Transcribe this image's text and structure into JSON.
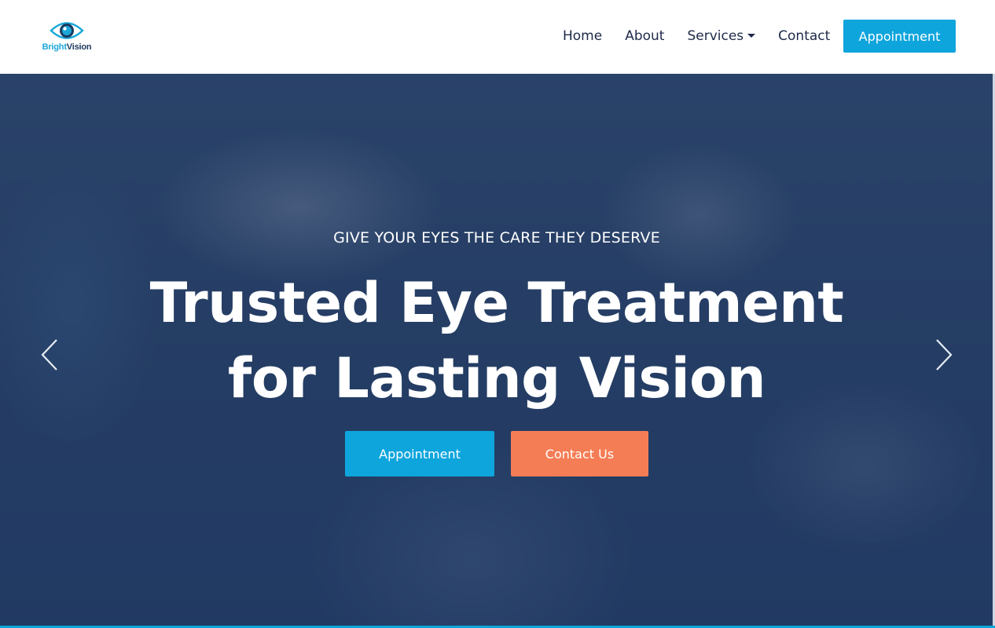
{
  "logo": {
    "bright": "Bright",
    "vision": "Vision",
    "icon": "eye-icon"
  },
  "nav": {
    "items": [
      {
        "label": "Home"
      },
      {
        "label": "About"
      },
      {
        "label": "Services",
        "has_dropdown": true
      },
      {
        "label": "Contact"
      }
    ],
    "cta_label": "Appointment"
  },
  "hero": {
    "tagline": "GIVE YOUR EYES THE CARE THEY DESERVE",
    "title_line1": "Trusted Eye Treatment",
    "title_line2": "for Lasting Vision",
    "primary_button": "Appointment",
    "secondary_button": "Contact Us",
    "prev_icon": "chevron-left-icon",
    "next_icon": "chevron-right-icon"
  },
  "colors": {
    "accent": "#0ea5dd",
    "secondary_accent": "#f47d55",
    "nav_text": "#1d2a48",
    "hero_overlay": "#172d56"
  }
}
